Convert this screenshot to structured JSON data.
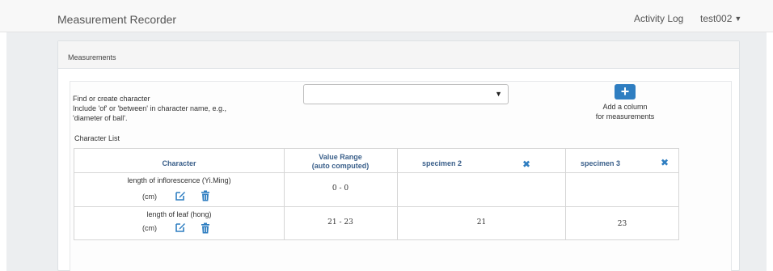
{
  "header": {
    "app_title": "Measurement Recorder",
    "activity_log": "Activity Log",
    "user": "test002",
    "user_caret": "▼"
  },
  "panel": {
    "title": "Measurements"
  },
  "find": {
    "label_line1": "Find or create character",
    "label_line2": "Include 'of' or 'between' in character name, e.g.,",
    "label_line3": "'diameter of ball'.",
    "select_value": "",
    "select_arrow": "▼"
  },
  "add_column": {
    "icon": "+",
    "label_line1": "Add a column",
    "label_line2": "for measurements"
  },
  "character_list": {
    "label": "Character List",
    "columns": {
      "character": "Character",
      "value_range_line1": "Value Range",
      "value_range_line2": "(auto computed)",
      "specimen_a": "specimen 2",
      "specimen_b": "specimen 3"
    },
    "rows": [
      {
        "name": "length of inflorescence (Yi.Ming)",
        "unit": "(cm)",
        "range": "0 - 0",
        "specimen_a": "",
        "specimen_b": ""
      },
      {
        "name": "length of leaf (hong)",
        "unit": "(cm)",
        "range": "21 - 23",
        "specimen_a": "21",
        "specimen_b": "23"
      }
    ]
  },
  "icons": {
    "edit": "edit-icon",
    "delete": "trash-icon",
    "remove": "close-icon",
    "accent": "#2f7ec1"
  }
}
